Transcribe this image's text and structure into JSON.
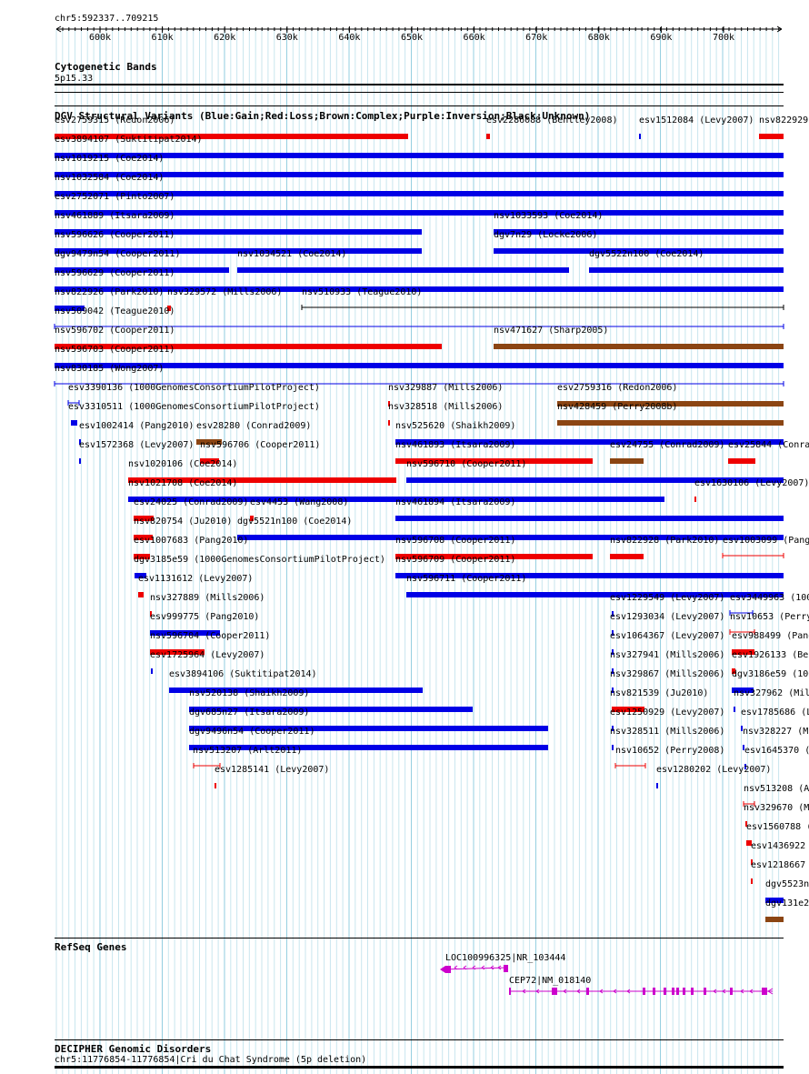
{
  "region": "chr5:592337..709215",
  "ruler": {
    "ticks": [
      "600k",
      "610k",
      "620k",
      "630k",
      "640k",
      "650k",
      "660k",
      "670k",
      "680k",
      "690k",
      "700k"
    ]
  },
  "cytoband": {
    "title": "Cytogenetic Bands",
    "band": "5p15.33"
  },
  "dgv": {
    "title": "DGV Structural Variants (Blue:Gain;Red:Loss;Brown:Complex;Purple:Inversion;Black:Unknown)",
    "colors": {
      "gain": "#0000e6",
      "loss": "#ee0000",
      "complex": "#8b4513",
      "unknown": "#000000"
    },
    "features": [
      {
        "label": "esv2759315 (Redon2006)",
        "type": "loss"
      },
      {
        "label": "esv2286088 (Bentley2008)",
        "type": "loss"
      },
      {
        "label": "esv1512084 (Levy2007)",
        "type": "gain"
      },
      {
        "label": "nsv822929",
        "type": "loss"
      },
      {
        "label": "esv3894107 (Suktitipat2014)",
        "type": "gain"
      },
      {
        "label": "nsv1019215 (Coe2014)",
        "type": "gain"
      },
      {
        "label": "nsv1032584 (Coe2014)",
        "type": "gain"
      },
      {
        "label": "esv2752071 (Pinto2007)",
        "type": "gain"
      },
      {
        "label": "nsv461889 (Itsara2009)",
        "type": "gain"
      },
      {
        "label": "nsv1033593 (Coe2014)",
        "type": "gain"
      },
      {
        "label": "nsv596626 (Cooper2011)",
        "type": "gain"
      },
      {
        "label": "dgv7n29 (Locke2006)",
        "type": "gain"
      },
      {
        "label": "dgv9479n54 (Cooper2011)",
        "type": "gain"
      },
      {
        "label": "nsv1034521 (Coe2014)",
        "type": "gain"
      },
      {
        "label": "dgv5522n100 (Coe2014)",
        "type": "gain"
      },
      {
        "label": "nsv596629 (Cooper2011)",
        "type": "gain"
      },
      {
        "label": "nsv822926 (Park2010)",
        "type": "gain"
      },
      {
        "label": "nsv329572 (Mills2006)",
        "type": "loss"
      },
      {
        "label": "nsv510933 (Teague2010)",
        "type": "unknown"
      },
      {
        "label": "nsv509042 (Teague2010)",
        "type": "gain"
      },
      {
        "label": "nsv596702 (Cooper2011)",
        "type": "loss"
      },
      {
        "label": "nsv471627 (Sharp2005)",
        "type": "complex"
      },
      {
        "label": "nsv596703 (Cooper2011)",
        "type": "gain"
      },
      {
        "label": "nsv830185 (Wong2007)",
        "type": "gain"
      },
      {
        "label": "esv3390136 (1000GenomesConsortiumPilotProject)",
        "type": "gain"
      },
      {
        "label": "nsv329887 (Mills2006)",
        "type": "loss"
      },
      {
        "label": "esv2759316 (Redon2006)",
        "type": "complex"
      },
      {
        "label": "esv3310511 (1000GenomesConsortiumPilotProject)",
        "type": "gain"
      },
      {
        "label": "nsv328518 (Mills2006)",
        "type": "loss"
      },
      {
        "label": "nsv428459 (Perry2008b)",
        "type": "complex"
      },
      {
        "label": "esv1002414 (Pang2010)",
        "type": "gain"
      },
      {
        "label": "esv28280 (Conrad2009)",
        "type": "complex"
      },
      {
        "label": "nsv525620 (Shaikh2009)",
        "type": "gain"
      },
      {
        "label": "esv1572368 (Levy2007)",
        "type": "gain"
      },
      {
        "label": "nsv596706 (Cooper2011)",
        "type": "loss"
      },
      {
        "label": "nsv461893 (Itsara2009)",
        "type": "loss"
      },
      {
        "label": "esv24755 (Conrad2009)",
        "type": "complex"
      },
      {
        "label": "esv25844 (Conra",
        "type": "loss"
      },
      {
        "label": "nsv1020106 (Coe2014)",
        "type": "loss"
      },
      {
        "label": "nsv596710 (Cooper2011)",
        "type": "gain"
      },
      {
        "label": "nsv1021708 (Coe2014)",
        "type": "gain"
      },
      {
        "label": "esv1630106 (Levy2007)",
        "type": "loss"
      },
      {
        "label": "esv24025 (Conrad2009)",
        "type": "loss"
      },
      {
        "label": "esv4453 (Wang2008)",
        "type": "loss"
      },
      {
        "label": "nsv461894 (Itsara2009)",
        "type": "gain"
      },
      {
        "label": "nsv820754 (Ju2010)",
        "type": "loss"
      },
      {
        "label": "dgv5521n100 (Coe2014)",
        "type": "gain"
      },
      {
        "label": "esv1007683 (Pang2010)",
        "type": "loss"
      },
      {
        "label": "nsv596708 (Cooper2011)",
        "type": "loss"
      },
      {
        "label": "nsv822928 (Park2010)",
        "type": "loss"
      },
      {
        "label": "esv1003099 (Pang",
        "type": "loss"
      },
      {
        "label": "dgv3185e59 (1000GenomesConsortiumPilotProject)",
        "type": "gain"
      },
      {
        "label": "nsv596709 (Cooper2011)",
        "type": "gain"
      },
      {
        "label": "esv1131612 (Levy2007)",
        "type": "loss"
      },
      {
        "label": "nsv596711 (Cooper2011)",
        "type": "gain"
      },
      {
        "label": "nsv327889 (Mills2006)",
        "type": "loss"
      },
      {
        "label": "esv1229549 (Levy2007)",
        "type": "gain"
      },
      {
        "label": "esv3449963 (100",
        "type": "gain"
      },
      {
        "label": "esv999775 (Pang2010)",
        "type": "gain"
      },
      {
        "label": "esv1293034 (Levy2007)",
        "type": "gain"
      },
      {
        "label": "nsv10653 (Perry",
        "type": "loss"
      },
      {
        "label": "nsv596704 (Cooper2011)",
        "type": "loss"
      },
      {
        "label": "esv1064367 (Levy2007)",
        "type": "gain"
      },
      {
        "label": "esv988499 (Pang",
        "type": "loss"
      },
      {
        "label": "esv1725964 (Levy2007)",
        "type": "gain"
      },
      {
        "label": "nsv327941 (Mills2006)",
        "type": "gain"
      },
      {
        "label": "esv1926133 (Ber",
        "type": "loss"
      },
      {
        "label": "esv3894106 (Suktitipat2014)",
        "type": "gain"
      },
      {
        "label": "nsv329867 (Mills2006)",
        "type": "gain"
      },
      {
        "label": "dgv3186e59 (100",
        "type": "gain"
      },
      {
        "label": "nsv520138 (Shaikh2009)",
        "type": "gain"
      },
      {
        "label": "nsv821539 (Ju2010)",
        "type": "loss"
      },
      {
        "label": "nsv327962 (Mil",
        "type": "gain"
      },
      {
        "label": "dgv685n27 (Itsara2009)",
        "type": "gain"
      },
      {
        "label": "esv1250929 (Levy2007)",
        "type": "gain"
      },
      {
        "label": "esv1785686 (L",
        "type": "gain"
      },
      {
        "label": "dgv9496n54 (Cooper2011)",
        "type": "gain"
      },
      {
        "label": "nsv328511 (Mills2006)",
        "type": "gain"
      },
      {
        "label": "nsv328227 (M",
        "type": "gain"
      },
      {
        "label": "nsv513207 (Arlt2011)",
        "type": "loss"
      },
      {
        "label": "nsv10652 (Perry2008)",
        "type": "loss"
      },
      {
        "label": "esv1645370 (",
        "type": "gain"
      },
      {
        "label": "esv1285141 (Levy2007)",
        "type": "loss"
      },
      {
        "label": "esv1280202 (Levy2007)",
        "type": "gain"
      },
      {
        "label": "nsv513208 (A",
        "type": "loss"
      },
      {
        "label": "nsv329670 (M",
        "type": "loss"
      },
      {
        "label": "esv1560788 (",
        "type": "loss"
      },
      {
        "label": "esv1436922",
        "type": "loss"
      },
      {
        "label": "esv1218667",
        "type": "loss"
      },
      {
        "label": "dgv5523n",
        "type": "gain"
      },
      {
        "label": "dgv131e2",
        "type": "complex"
      }
    ]
  },
  "refseq": {
    "title": "RefSeq Genes",
    "color": "#cc00cc",
    "genes": [
      {
        "label": "LOC100996325|NR_103444"
      },
      {
        "label": "CEP72|NM_018140"
      }
    ]
  },
  "decipher": {
    "title": "DECIPHER Genomic Disorders",
    "label": "chr5:11776854-11776854|Cri du Chat Syndrome (5p deletion)"
  }
}
